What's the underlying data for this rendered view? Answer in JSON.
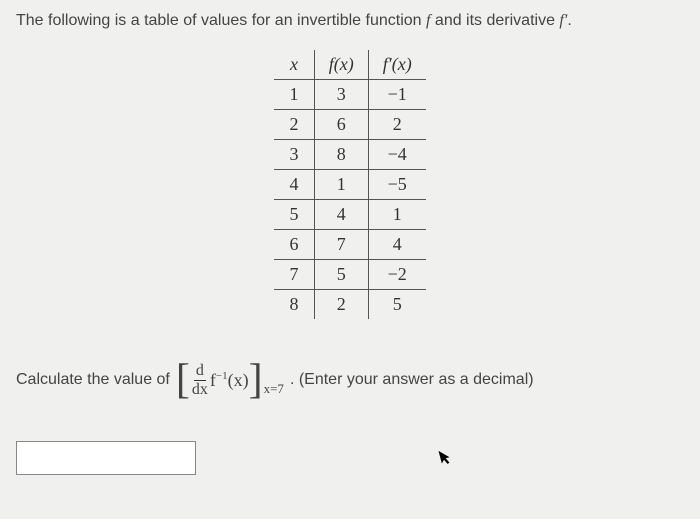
{
  "problem_text_pre": "The following is a table of values for an invertible function ",
  "problem_text_f": "f",
  "problem_text_mid": " and its derivative ",
  "problem_text_fp": "f′",
  "problem_text_end": ".",
  "table": {
    "headers": [
      "x",
      "f(x)",
      "f′(x)"
    ],
    "rows": [
      [
        "1",
        "3",
        "−1"
      ],
      [
        "2",
        "6",
        "2"
      ],
      [
        "3",
        "8",
        "−4"
      ],
      [
        "4",
        "1",
        "−5"
      ],
      [
        "5",
        "4",
        "1"
      ],
      [
        "6",
        "7",
        "4"
      ],
      [
        "7",
        "5",
        "−2"
      ],
      [
        "8",
        "2",
        "5"
      ]
    ]
  },
  "calc_prefix": "Calculate the value of ",
  "formula": {
    "frac_num": "d",
    "frac_den": "dx",
    "func": "f",
    "exp": "−1",
    "arg": "(x)",
    "eval": "x=7"
  },
  "calc_suffix": ". (Enter your answer as a decimal)",
  "answer_placeholder": ""
}
